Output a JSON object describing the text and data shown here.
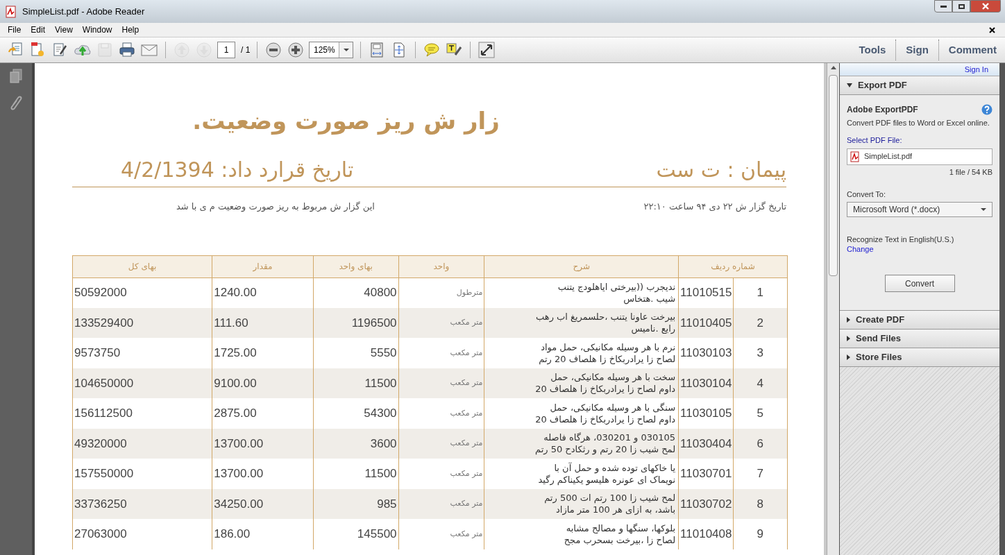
{
  "window": {
    "title": "SimpleList.pdf - Adobe Reader"
  },
  "menu": {
    "file": "File",
    "edit": "Edit",
    "view": "View",
    "window": "Window",
    "help": "Help"
  },
  "toolbar": [
    {
      "kind": "create",
      "disabled": false
    },
    {
      "kind": "pdf",
      "disabled": false
    },
    {
      "kind": "edit",
      "disabled": false
    },
    {
      "kind": "cloud",
      "disabled": false
    },
    {
      "kind": "save",
      "disabled": true
    },
    {
      "kind": "print",
      "disabled": false
    },
    {
      "kind": "mail",
      "disabled": false
    },
    {
      "kind": "sep"
    },
    {
      "kind": "up",
      "disabled": true
    },
    {
      "kind": "down",
      "disabled": true
    },
    {
      "kind": "page"
    },
    {
      "kind": "sep"
    },
    {
      "kind": "zoomout",
      "disabled": false
    },
    {
      "kind": "zoomin",
      "disabled": false
    },
    {
      "kind": "zoom"
    },
    {
      "kind": "sep"
    },
    {
      "kind": "fitpage",
      "disabled": false
    },
    {
      "kind": "fitwidth",
      "disabled": false
    },
    {
      "kind": "sep"
    },
    {
      "kind": "comment",
      "disabled": false
    },
    {
      "kind": "highlight",
      "disabled": false
    },
    {
      "kind": "sep"
    },
    {
      "kind": "fullscreen",
      "disabled": false
    }
  ],
  "page_field": {
    "value": "1",
    "total": "/ 1"
  },
  "zoom_field": {
    "value": "125%"
  },
  "right_tabs": {
    "tools": "Tools",
    "sign": "Sign",
    "comment": "Comment"
  },
  "document": {
    "title": "زار ش ریز صورت وضعیت.",
    "contract": "پیمان : ت ست",
    "contract_date": "تاریخ قرارد داد: 4/2/1394",
    "report_date": "تاریخ گزار ش ۲۲ دی ۹۴  ساعت ۲۲:۱۰",
    "note": "این گزار ش مربوط به ریز صورت وضعیت م ی با شد",
    "table": {
      "columns": [
        "شماره ردیف",
        "شرح",
        "واحد",
        "بهای واحد",
        "مقدار",
        "بهای کل"
      ],
      "rows": [
        {
          "index": "1",
          "code": "11010515",
          "description": [
            "ندیجرب ((بیرختی ایاهلودج یتنب",
            "شیب .هتخاس"
          ],
          "unit": "مترطول",
          "unit_price": "40800",
          "quantity": "1240.00",
          "total": "50592000"
        },
        {
          "index": "2",
          "code": "11010405",
          "description": [
            "بیرخت عاونا یتنب ،حلسمریغ اب رهب",
            "رایع .ناميس"
          ],
          "unit": "متر مکعب",
          "unit_price": "1196500",
          "quantity": "111.60",
          "total": "133529400"
        },
        {
          "index": "3",
          "code": "11030103",
          "description": [
            "نرم با هر وسیله مکانیکی، حمل مواد",
            "لصاح زا یرادربکاخ زا هلصاف 20 رتم"
          ],
          "unit": "متر مکعب",
          "unit_price": "5550",
          "quantity": "1725.00",
          "total": "9573750"
        },
        {
          "index": "4",
          "code": "11030104",
          "description": [
            "سخت با هر وسیله مکانیکی، حمل",
            "داوم لصاح زا یرادربکاخ زا هلصاف 20"
          ],
          "unit": "متر مکعب",
          "unit_price": "11500",
          "quantity": "9100.00",
          "total": "104650000"
        },
        {
          "index": "5",
          "code": "11030105",
          "description": [
            "سنگی با هر وسیله مکانیکی، حمل",
            "داوم لصاح زا یرادربکاخ زا هلصاف 20"
          ],
          "unit": "متر مکعب",
          "unit_price": "54300",
          "quantity": "2875.00",
          "total": "156112500"
        },
        {
          "index": "6",
          "code": "11030404",
          "description": [
            "030105 و 030201، هرگاه فاصله",
            "لمح شیب زا 20 رتم و رثکادح 50 رتم"
          ],
          "unit": "متر مکعب",
          "unit_price": "3600",
          "quantity": "13700.00",
          "total": "49320000"
        },
        {
          "index": "7",
          "code": "11030701",
          "description": [
            "یا خاکهای توده شده و حمل آن با",
            "نویماک ای عونره هلیسو یکیناکم رگید"
          ],
          "unit": "متر مکعب",
          "unit_price": "11500",
          "quantity": "13700.00",
          "total": "157550000"
        },
        {
          "index": "8",
          "code": "11030702",
          "description": [
            "لمح شیب زا 100 رتم ات 500 رتم",
            "باشد، به ازای هر 100 متر مازاد"
          ],
          "unit": "متر مکعب",
          "unit_price": "985",
          "quantity": "34250.00",
          "total": "33736250"
        },
        {
          "index": "9",
          "code": "11010408",
          "description": [
            "بلوکها، سنگها و مصالح مشابه",
            "لصاح زا ،بیرخت بسحرب مجح"
          ],
          "unit": "متر مکعب",
          "unit_price": "145500",
          "quantity": "186.00",
          "total": "27063000"
        }
      ]
    }
  },
  "panel": {
    "sign_in": "Sign In",
    "sections": [
      {
        "title": "Export PDF",
        "expanded": true
      },
      {
        "title": "Create PDF",
        "expanded": false
      },
      {
        "title": "Send Files",
        "expanded": false
      },
      {
        "title": "Store Files",
        "expanded": false
      }
    ],
    "export": {
      "heading": "Adobe ExportPDF",
      "description": "Convert PDF files to Word or Excel online.",
      "select_label": "Select PDF File:",
      "file": "SimpleList.pdf",
      "file_info": "1 file / 54 KB",
      "convert_label": "Convert To:",
      "format": "Microsoft Word (*.docx)",
      "recognize": "Recognize Text in English(U.S.)",
      "change": "Change",
      "button": "Convert"
    }
  }
}
